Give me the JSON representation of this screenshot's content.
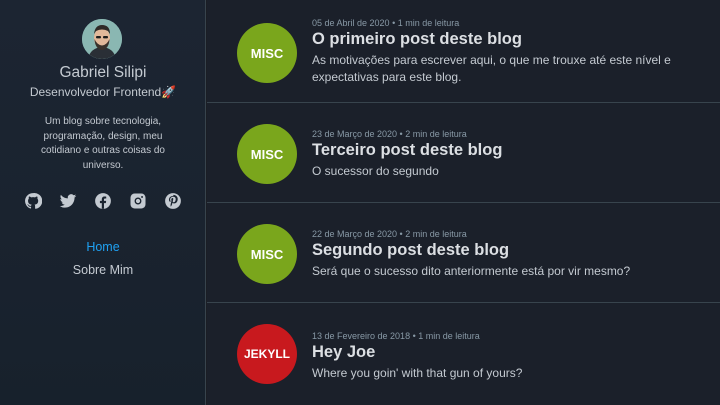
{
  "sidebar": {
    "name": "Gabriel Silipi",
    "role": "Desenvolvedor Frontend🚀",
    "description": "Um blog sobre tecnologia, programação, design, meu cotidiano e outras coisas do universo.",
    "social_icons": [
      "github-icon",
      "twitter-icon",
      "facebook-icon",
      "instagram-icon",
      "pinterest-icon"
    ],
    "nav": [
      {
        "label": "Home",
        "active": true
      },
      {
        "label": "Sobre Mim",
        "active": false
      }
    ]
  },
  "colors": {
    "misc": "#7aa61c",
    "jekyll": "#c8191e",
    "link_active": "#1fa1f2"
  },
  "posts": [
    {
      "category": "MISC",
      "meta": "05 de Abril de 2020 • 1 min de leitura",
      "title": "O primeiro post deste blog",
      "description": "As motivações para escrever aqui, o que me trouxe até este nível e expectativas para este blog."
    },
    {
      "category": "MISC",
      "meta": "23 de Março de 2020 • 2 min de leitura",
      "title": "Terceiro post deste blog",
      "description": "O sucessor do segundo"
    },
    {
      "category": "MISC",
      "meta": "22 de Março de 2020 • 2 min de leitura",
      "title": "Segundo post deste blog",
      "description": "Será que o sucesso dito anteriormente está por vir mesmo?"
    },
    {
      "category": "JEKYLL",
      "meta": "13 de Fevereiro de 2018 • 1 min de leitura",
      "title": "Hey Joe",
      "description": "Where you goin' with that gun of yours?"
    }
  ]
}
